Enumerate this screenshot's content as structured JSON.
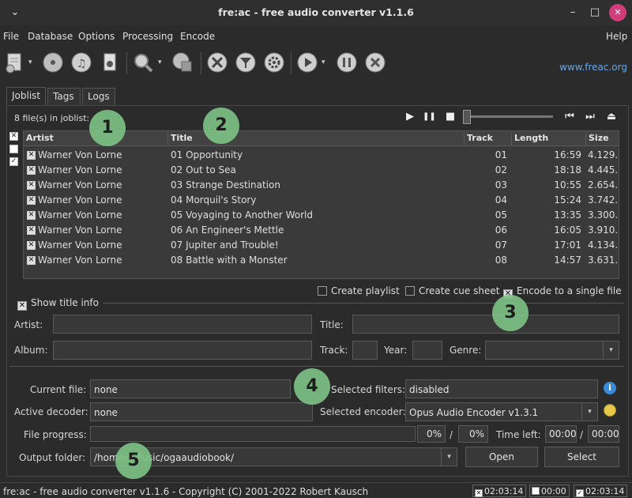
{
  "window": {
    "title": "fre:ac - free audio converter v1.1.6",
    "minimize_glyph": "–",
    "maximize_glyph": "□",
    "close_glyph": "✕",
    "menu_glyph": "⌄"
  },
  "menu": [
    "File",
    "Database",
    "Options",
    "Processing",
    "Encode",
    "Help"
  ],
  "toolbar": {
    "icons": [
      "add-files-icon",
      "add-cd-icon",
      "music-icon",
      "remove-icon",
      "search-database-icon",
      "cddb-icon",
      "settings-tools-icon",
      "filter-icon",
      "gear-icon",
      "play-encode-icon",
      "pause-icon",
      "stop-icon"
    ],
    "dropdown_glyph": "▾",
    "link": "www.freac.org"
  },
  "tabs": [
    "Joblist",
    "Tags",
    "Logs"
  ],
  "joblist": {
    "count_text": "8 file(s) in joblist:",
    "columns": [
      "Artist",
      "Title",
      "Track",
      "Length",
      "Size"
    ],
    "rows": [
      {
        "artist": "Warner Von Lorne",
        "title": "01 Opportunity",
        "track": "01",
        "length": "16:59",
        "size": "4.129."
      },
      {
        "artist": "Warner Von Lorne",
        "title": "02 Out to Sea",
        "track": "02",
        "length": "18:18",
        "size": "4.445."
      },
      {
        "artist": "Warner Von Lorne",
        "title": "03 Strange Destination",
        "track": "03",
        "length": "10:55",
        "size": "2.654."
      },
      {
        "artist": "Warner Von Lorne",
        "title": "04 Morquil's Story",
        "track": "04",
        "length": "15:24",
        "size": "3.742."
      },
      {
        "artist": "Warner Von Lorne",
        "title": "05 Voyaging to Another World",
        "track": "05",
        "length": "13:35",
        "size": "3.300."
      },
      {
        "artist": "Warner Von Lorne",
        "title": "06 An Engineer's Mettle",
        "track": "06",
        "length": "16:05",
        "size": "3.910."
      },
      {
        "artist": "Warner Von Lorne",
        "title": "07 Jupiter and Trouble!",
        "track": "07",
        "length": "17:01",
        "size": "4.134."
      },
      {
        "artist": "Warner Von Lorne",
        "title": "08 Battle with a Monster",
        "track": "08",
        "length": "14:57",
        "size": "3.631."
      }
    ],
    "check_glyph": "✕"
  },
  "player": {
    "play": "▶",
    "pause": "❚❚",
    "stop": "■",
    "prev": "⏮",
    "next": "⏭",
    "eject": "⏏"
  },
  "options": {
    "create_playlist": "Create playlist",
    "create_cue_sheet": "Create cue sheet",
    "encode_single": "Encode to a single file",
    "show_title_info": "Show title info"
  },
  "title_info": {
    "artist_label": "Artist:",
    "title_label": "Title:",
    "album_label": "Album:",
    "track_label": "Track:",
    "year_label": "Year:",
    "genre_label": "Genre:"
  },
  "status": {
    "current_file_label": "Current file:",
    "current_file": "none",
    "selected_filters_label": "Selected filters:",
    "selected_filters": "disabled",
    "active_decoder_label": "Active decoder:",
    "active_decoder": "none",
    "selected_encoder_label": "Selected encoder:",
    "selected_encoder": "Opus Audio Encoder v1.3.1",
    "file_progress_label": "File progress:",
    "file_percent": "0%",
    "total_percent": "0%",
    "slash": "/",
    "time_left_label": "Time left:",
    "time_left": "00:00",
    "time_total": "00:00",
    "output_folder_label": "Output folder:",
    "output_folder": "/home/   /Music/ogaaudiobook/",
    "open_button": "Open",
    "select_button": "Select"
  },
  "badges": [
    "1",
    "2",
    "3",
    "4",
    "5"
  ],
  "statusbar": {
    "text": "fre:ac - free audio converter v1.1.6 - Copyright (C) 2001-2022 Robert Kausch",
    "time1": "02:03:14",
    "time2": "00:00",
    "time3": "02:03:14"
  }
}
